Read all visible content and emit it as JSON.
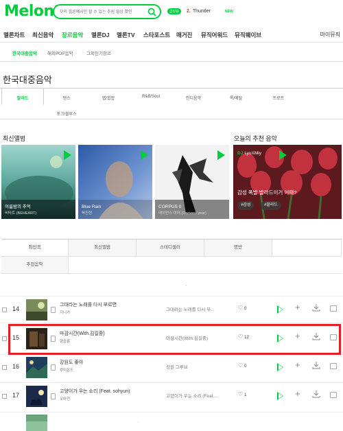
{
  "header": {
    "logo": "Melon",
    "search_placeholder": "모의 필른예사인 할 수 있는 추원 영상 확인",
    "live_badge": "급상승",
    "ticker_rank": "2.",
    "ticker_title": "Thunder",
    "new_badge": "NEW"
  },
  "gnb": {
    "items": [
      "멜론차트",
      "최신음악",
      "장르음악",
      "멜론DJ",
      "멜론TV",
      "스타포스트",
      "매거진",
      "뮤직어워드",
      "뮤직웨이브"
    ],
    "active_index": 2,
    "mymusic": "마이뮤직"
  },
  "subnav": {
    "items": [
      "한국대중음악",
      "해외POP음악",
      "그외인기장르"
    ]
  },
  "page_title": "한국대중음악",
  "genres": {
    "row1": [
      "발라드",
      "댄스",
      "랩/힙합",
      "R&B/Soul",
      "인디음악",
      "록/메탈",
      "트로트"
    ],
    "row2": [
      "포크/블루스"
    ]
  },
  "latest_albums": {
    "heading": "최신앨범",
    "items": [
      {
        "title": "여름밤의 추억",
        "artist": "비타트 (BEHEART)"
      },
      {
        "title": "Blue Rain",
        "artist": "육진현"
      },
      {
        "title": "CORPUS 0",
        "artist": "데이먼스 이어 (Damons year)"
      }
    ]
  },
  "recommend": {
    "heading": "오늘의 추천 음악",
    "dj_label": "DJ",
    "dj_name": "LyuXMiy",
    "title": "감성 폭발 발라드이거 어때?",
    "tags": [
      "#감성",
      "#발라드"
    ]
  },
  "list_tabs": {
    "row1": [
      "최신곡",
      "최신앨범",
      "스테디셀러",
      "명반"
    ],
    "row2": [
      "추천음악"
    ]
  },
  "dots": "·",
  "songs": [
    {
      "rank": "14",
      "title": "그대라는 노래를 다시 부르면",
      "artist": "지니카",
      "album": "그대라는 노래를 다시 부...",
      "likes": "0"
    },
    {
      "rank": "15",
      "title": "마감시간(With.김길중)",
      "artist": "형승훈",
      "album": "마감시간(With.김길중)",
      "likes": "12"
    },
    {
      "rank": "16",
      "title": "강원도 좋아",
      "artist": "루미온드",
      "album": "강원 그루브",
      "likes": "0"
    },
    {
      "rank": "17",
      "title": "고양이가 우는 소리 (Feat. sohyun)",
      "artist": "꼬마건",
      "album": "고양이가 우는 소리 (Feat....",
      "likes": "1"
    }
  ],
  "colors": {
    "brand": "#00cd3c",
    "highlight": "#e31e24"
  }
}
